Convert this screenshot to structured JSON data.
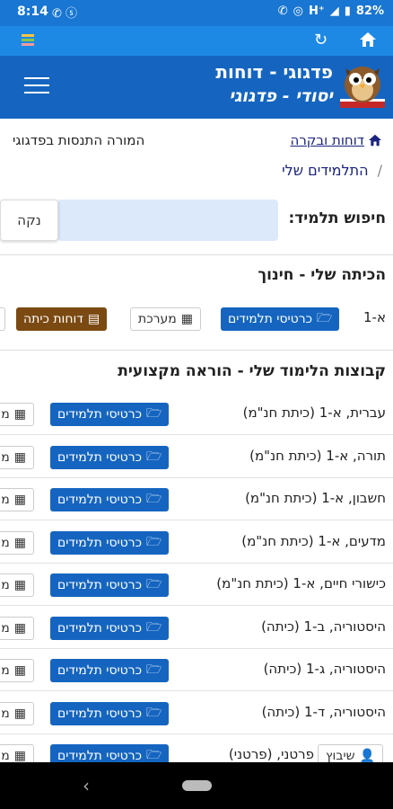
{
  "status_bar": {
    "time": "8:14",
    "network": "H⁺",
    "battery": "82%"
  },
  "header": {
    "title": "פדגוגי - דוחות",
    "subtitle": "יסודי - פדגוגי"
  },
  "breadcrumb": {
    "link": "דוחות ובקרה",
    "current": "התלמידים שלי",
    "note": "המורה התנסות בפדגוגי"
  },
  "search": {
    "label": "חיפוש תלמיד:",
    "value": "",
    "clear_label": "נקה"
  },
  "my_class": {
    "title": "הכיתה שלי - חינוך",
    "class_name": "א-1",
    "cards_label": "כרטיסי תלמידים",
    "system_label": "מערכת",
    "reports_label": "דוחות כיתה"
  },
  "groups": {
    "title": "קבוצות הלימוד שלי - הוראה מקצועית",
    "cards_label": "כרטיסי תלמידים",
    "system_label_partial": "מ",
    "placement_label": "שיבוץ",
    "rows": [
      {
        "label": "עברית, א-1 (כיתת חנ\"מ)"
      },
      {
        "label": "תורה, א-1 (כיתת חנ\"מ)"
      },
      {
        "label": "חשבון, א-1 (כיתת חנ\"מ)"
      },
      {
        "label": "מדעים, א-1 (כיתת חנ\"מ)"
      },
      {
        "label": "כישורי חיים, א-1 (כיתת חנ\"מ)"
      },
      {
        "label": "היסטוריה, ב-1 (כיתה)"
      },
      {
        "label": "היסטוריה, ג-1 (כיתה)"
      },
      {
        "label": "היסטוריה, ד-1 (כיתה)"
      },
      {
        "label": "פרטני, (פרטני)"
      }
    ]
  },
  "colors": {
    "status_bar": "#1976d2",
    "toolbar": "#1e88e5",
    "header": "#1565c0",
    "button_blue": "#1565c0",
    "button_brown": "#7b4a12",
    "search_bg": "#dbe9fb"
  }
}
